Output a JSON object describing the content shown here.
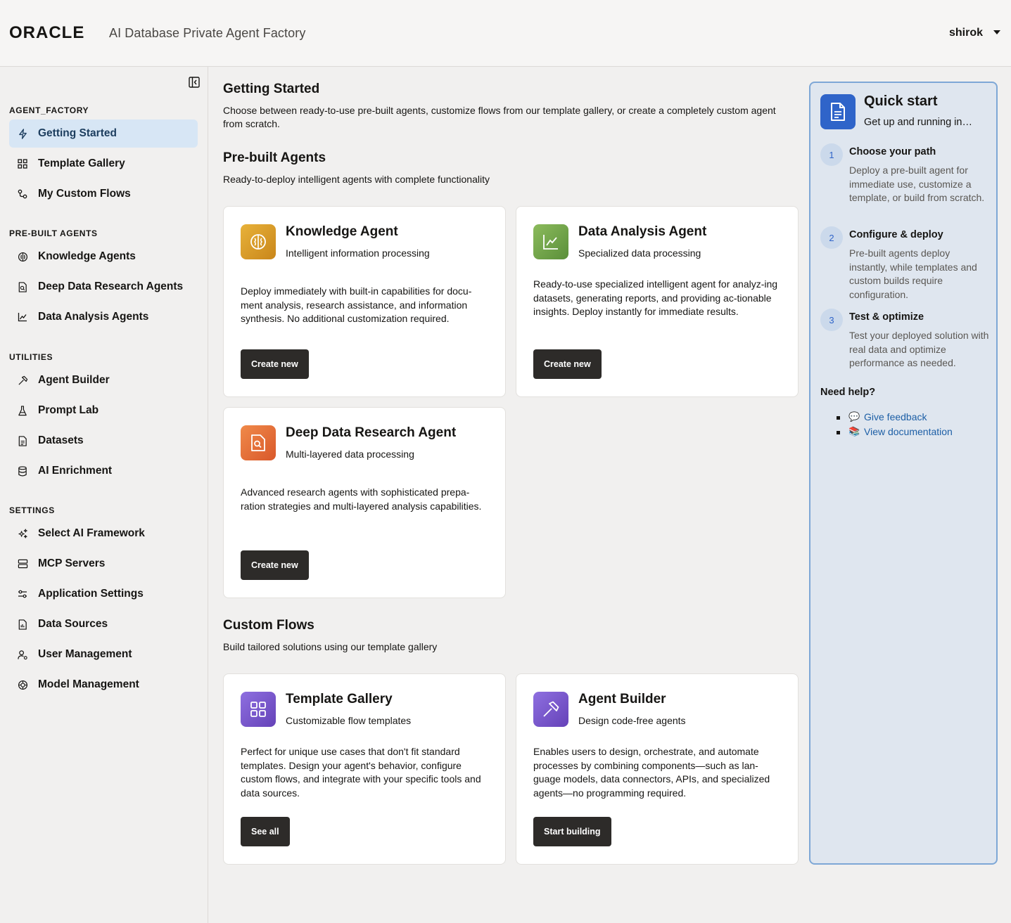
{
  "header": {
    "brand": "ORACLE",
    "app_title": "AI Database Private Agent Factory",
    "user": "shirok"
  },
  "sidebar": {
    "sections": [
      {
        "title": "AGENT_FACTORY",
        "items": [
          {
            "label": "Getting Started",
            "icon": "lightning-icon",
            "active": true
          },
          {
            "label": "Template Gallery",
            "icon": "grid-icon"
          },
          {
            "label": "My Custom Flows",
            "icon": "flow-icon"
          }
        ]
      },
      {
        "title": "PRE-BUILT AGENTS",
        "items": [
          {
            "label": "Knowledge Agents",
            "icon": "brain-icon"
          },
          {
            "label": "Deep Data Research Agents",
            "icon": "file-search-icon"
          },
          {
            "label": "Data Analysis Agents",
            "icon": "chart-line-icon"
          }
        ]
      },
      {
        "title": "UTILITIES",
        "items": [
          {
            "label": "Agent Builder",
            "icon": "hammer-icon"
          },
          {
            "label": "Prompt Lab",
            "icon": "flask-icon"
          },
          {
            "label": "Datasets",
            "icon": "document-icon"
          },
          {
            "label": "AI Enrichment",
            "icon": "database-icon"
          }
        ]
      },
      {
        "title": "SETTINGS",
        "items": [
          {
            "label": "Select AI Framework",
            "icon": "sparkle-icon"
          },
          {
            "label": "MCP Servers",
            "icon": "server-icon"
          },
          {
            "label": "Application Settings",
            "icon": "sliders-icon"
          },
          {
            "label": "Data Sources",
            "icon": "file-data-icon"
          },
          {
            "label": "User Management",
            "icon": "user-gear-icon"
          },
          {
            "label": "Model Management",
            "icon": "model-icon"
          }
        ]
      }
    ]
  },
  "main": {
    "getting_started": {
      "title": "Getting Started",
      "description": "Choose between ready-to-use pre-built agents, customize flows from our template gallery, or create a completely custom agent from scratch."
    },
    "prebuilt": {
      "title": "Pre-built Agents",
      "description": "Ready-to-deploy intelligent agents with complete functionality",
      "cards": [
        {
          "title": "Knowledge Agent",
          "subtitle": "Intelligent information processing",
          "description": "Deploy immediately with built-in capabilities for docu-ment analysis, research assistance, and information synthesis. No additional customization required.",
          "button": "Create new",
          "icon": "brain-icon",
          "color": "#d99a1e"
        },
        {
          "title": "Data Analysis Agent",
          "subtitle": "Specialized data processing",
          "description": "Ready-to-use specialized intelligent agent for analyz-ing datasets, generating reports, and providing ac-tionable insights. Deploy instantly for immediate results.",
          "button": "Create new",
          "icon": "chart-line-icon",
          "color": "#6ea14a"
        },
        {
          "title": "Deep Data Research Agent",
          "subtitle": "Multi-layered data processing",
          "description": "Advanced research agents with sophisticated prepa-ration strategies and multi-layered analysis capabilities.",
          "button": "Create new",
          "icon": "file-search-icon",
          "color": "#e8703a"
        }
      ]
    },
    "custom": {
      "title": "Custom Flows",
      "description": "Build tailored solutions using our template gallery",
      "cards": [
        {
          "title": "Template Gallery",
          "subtitle": "Customizable flow templates",
          "description": "Perfect for unique use cases that don't fit standard templates. Design your agent's behavior, configure custom flows, and integrate with your specific tools and data sources.",
          "button": "See all",
          "icon": "grid-icon",
          "color": "#7856c9"
        },
        {
          "title": "Agent Builder",
          "subtitle": "Design code-free agents",
          "description": "Enables users to design, orchestrate, and automate processes by combining components—such as lan-guage models, data connectors, APIs, and specialized agents—no programming required.",
          "button": "Start building",
          "icon": "hammer-icon",
          "color": "#7856c9"
        }
      ]
    }
  },
  "quick_start": {
    "title": "Quick start",
    "subtitle": "Get up and running in…",
    "steps": [
      {
        "num": "1",
        "title": "Choose your path",
        "description": "Deploy a pre-built agent for immediate use, customize a template, or build from scratch."
      },
      {
        "num": "2",
        "title": "Configure & deploy",
        "description": "Pre-built agents deploy instantly, while templates and custom builds require configuration."
      },
      {
        "num": "3",
        "title": "Test & optimize",
        "description": "Test your deployed solution with real data and optimize performance as needed."
      }
    ],
    "help": {
      "title": "Need help?",
      "links": [
        {
          "emoji": "💬",
          "label": "Give feedback"
        },
        {
          "emoji": "📚",
          "label": "View documentation"
        }
      ]
    }
  },
  "colors": {
    "accent": "#2f64c9",
    "active_nav_bg": "#d7e6f5",
    "button_bg": "#2d2b29",
    "quick_start_bg": "#dfe6ef",
    "quick_start_border": "#7ea7d6"
  }
}
